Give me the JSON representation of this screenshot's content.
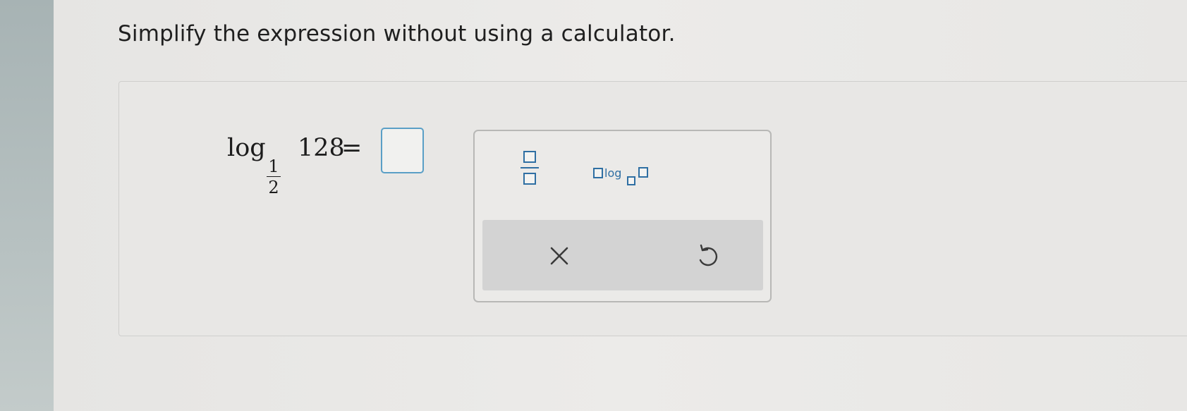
{
  "prompt": "Simplify the expression without using a calculator.",
  "expression": {
    "log": "log",
    "base_numerator": "1",
    "base_denominator": "2",
    "argument": "128",
    "equals": "="
  },
  "answer_input": {
    "value": ""
  },
  "palette": {
    "tools": [
      {
        "name": "fraction",
        "icon": "fraction-template-icon"
      },
      {
        "name": "logarithm",
        "label": "log",
        "icon": "log-base-template-icon"
      }
    ],
    "actions": [
      {
        "name": "clear",
        "icon": "close-icon"
      },
      {
        "name": "undo",
        "icon": "undo-icon"
      }
    ]
  },
  "colors": {
    "accent": "#2f6fa3",
    "input_border": "#5a9fc6",
    "action_bar": "#d3d3d3"
  }
}
